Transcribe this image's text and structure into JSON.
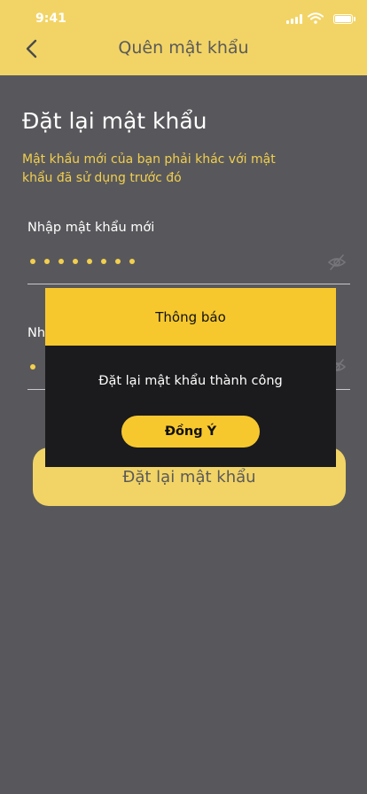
{
  "status_bar": {
    "time": "9:41"
  },
  "header": {
    "title": "Quên mật khẩu"
  },
  "main": {
    "title": "Đặt lại mật khẩu",
    "subtitle": "Mật khẩu mới của bạn phải khác với mật khẩu đã sử dụng trước đó",
    "new_password": {
      "label": "Nhập mật khẩu mới",
      "dots": 8
    },
    "confirm_password": {
      "label": "Nh",
      "dots": 1
    },
    "submit_label": "Đặt lại mật khẩu"
  },
  "dialog": {
    "title": "Thông báo",
    "message": "Đặt lại mật khẩu thành công",
    "ok_label": "Đồng Ý"
  },
  "colors": {
    "header_bg": "#f2d466",
    "page_bg": "#58585c",
    "accent": "#f2cf4e",
    "dialog_bg": "#1b1b1d",
    "dialog_head": "#f7c82e"
  },
  "icons": [
    "back-chevron-icon",
    "signal-icon",
    "wifi-icon",
    "battery-icon",
    "eye-off-icon"
  ]
}
